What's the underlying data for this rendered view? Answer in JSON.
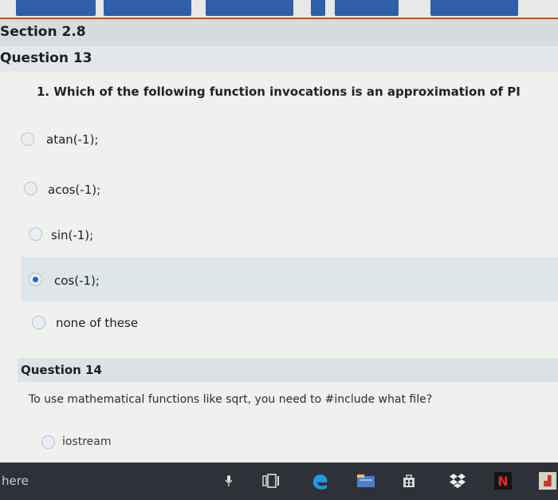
{
  "section": {
    "title": "Section 2.8"
  },
  "question13": {
    "header": "Question 13",
    "prompt": "1. Which of the following function invocations is an approximation of PI",
    "choices": [
      {
        "label": "atan(-1);",
        "checked": false
      },
      {
        "label": "acos(-1);",
        "checked": false
      },
      {
        "label": "sin(-1);",
        "checked": false
      },
      {
        "label": "cos(-1);",
        "checked": true
      },
      {
        "label": "none of these",
        "checked": false
      }
    ]
  },
  "question14": {
    "header": "Question 14",
    "prompt": "To use mathematical functions like sqrt, you need to #include what file?",
    "choices": [
      {
        "label": "iostream",
        "checked": false
      }
    ]
  },
  "taskbar": {
    "search_text": "here",
    "icons": [
      "microphone-icon",
      "task-view-icon",
      "edge-icon",
      "file-explorer-icon",
      "store-icon",
      "dropbox-icon",
      "netflix-icon",
      "app-icon"
    ]
  },
  "colors": {
    "accent": "#1f67c4",
    "selected_bg": "#dfe6e9",
    "taskbar_bg": "#2f3138"
  }
}
